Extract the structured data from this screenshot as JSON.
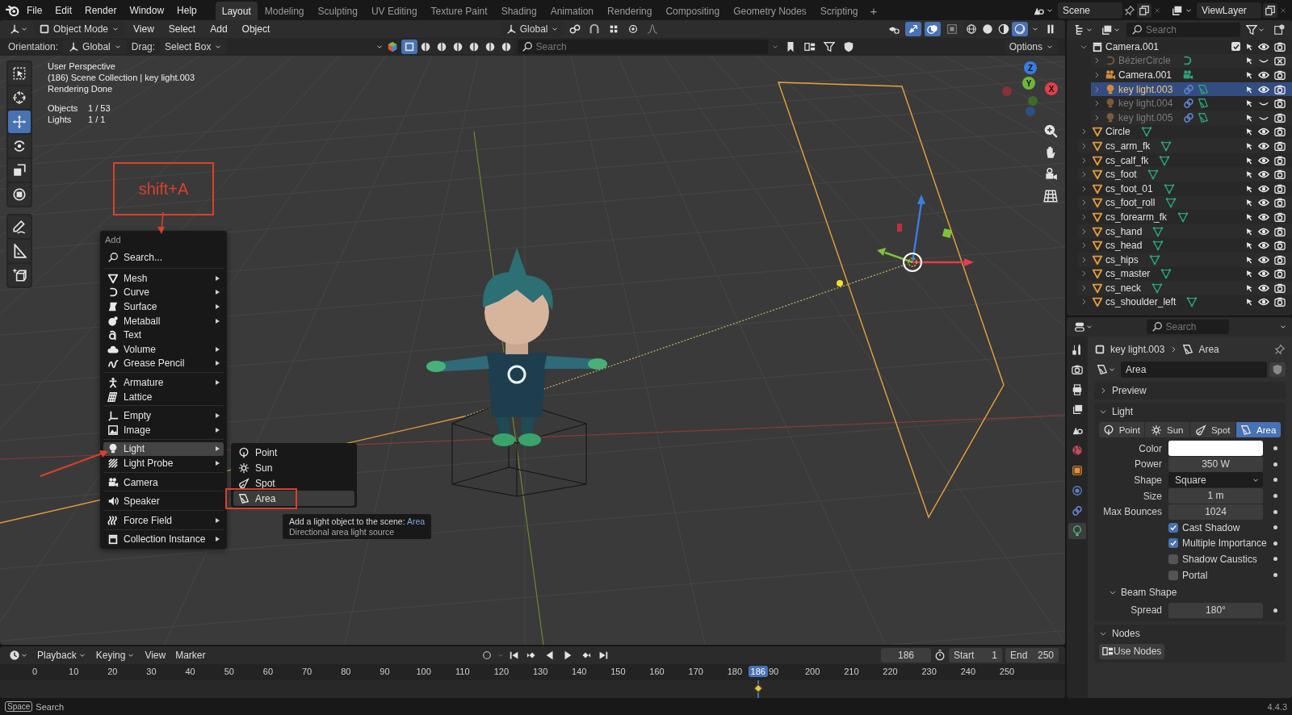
{
  "topbar": {
    "menus": [
      "File",
      "Edit",
      "Render",
      "Window",
      "Help"
    ],
    "workspaces": [
      {
        "label": "Layout",
        "selected": true
      },
      {
        "label": "Modeling",
        "selected": false
      },
      {
        "label": "Sculpting",
        "selected": false
      },
      {
        "label": "UV Editing",
        "selected": false
      },
      {
        "label": "Texture Paint",
        "selected": false
      },
      {
        "label": "Shading",
        "selected": false
      },
      {
        "label": "Animation",
        "selected": false
      },
      {
        "label": "Rendering",
        "selected": false
      },
      {
        "label": "Compositing",
        "selected": false
      },
      {
        "label": "Geometry Nodes",
        "selected": false
      },
      {
        "label": "Scripting",
        "selected": false
      }
    ],
    "add_tab": "+",
    "scene": "Scene",
    "view_layer": "ViewLayer"
  },
  "viewport": {
    "mode": "Object Mode",
    "menus": [
      "View",
      "Select",
      "Add",
      "Object"
    ],
    "transform": "Global",
    "toggles": [
      {
        "kind": "gizmo",
        "on": true
      },
      {
        "kind": "overlay",
        "on": true
      },
      {
        "kind": "xray",
        "on": false
      }
    ],
    "shading": [
      {
        "kind": "wire",
        "selected": false
      },
      {
        "kind": "solid",
        "selected": false
      },
      {
        "kind": "material",
        "selected": false
      },
      {
        "kind": "rendered",
        "selected": true
      }
    ],
    "orientation_label": "Orientation:",
    "orientation": "Global",
    "drag_label": "Drag:",
    "drag": "Select Box",
    "select_modes": [
      {
        "selected": true
      },
      {
        "selected": false
      },
      {
        "selected": false
      },
      {
        "selected": false
      },
      {
        "selected": false
      },
      {
        "selected": false
      },
      {
        "selected": false
      }
    ],
    "search_placeholder": "Search",
    "options": "Options",
    "overlay": [
      "User Perspective",
      "(186) Scene Collection | key light.003",
      "Rendering Done"
    ],
    "stats": [
      {
        "label": "Objects",
        "value": "1 / 53"
      },
      {
        "label": "Lights",
        "value": "1 / 1"
      }
    ],
    "tools": [
      {
        "kind": "select",
        "selected": false
      },
      {
        "kind": "cursor",
        "selected": false
      },
      {
        "kind": "move",
        "selected": true
      },
      {
        "kind": "rotate",
        "selected": false
      },
      {
        "kind": "scale",
        "selected": false
      },
      {
        "kind": "transform",
        "selected": false
      },
      {
        "kind": "annotate",
        "selected": false
      },
      {
        "kind": "measure",
        "selected": false
      },
      {
        "kind": "add_cube",
        "selected": false
      }
    ],
    "axes": [
      {
        "kind": "z",
        "label": "Z"
      },
      {
        "kind": "y",
        "label": "Y"
      },
      {
        "kind": "x",
        "label": "X"
      }
    ],
    "annotation": "shift+A",
    "add_menu": {
      "title": "Add",
      "search": "Search...",
      "groups": [
        [
          {
            "kind": "mesh",
            "label": "Mesh",
            "submenu": true,
            "selected": false
          },
          {
            "kind": "curve",
            "label": "Curve",
            "submenu": true,
            "selected": false
          },
          {
            "kind": "surface",
            "label": "Surface",
            "submenu": true,
            "selected": false
          },
          {
            "kind": "metaball",
            "label": "Metaball",
            "submenu": true,
            "selected": false
          },
          {
            "kind": "text",
            "label": "Text",
            "submenu": false,
            "selected": false
          },
          {
            "kind": "volume",
            "label": "Volume",
            "submenu": true,
            "selected": false
          },
          {
            "kind": "grease_pencil",
            "label": "Grease Pencil",
            "submenu": true,
            "selected": false
          }
        ],
        [
          {
            "kind": "armature",
            "label": "Armature",
            "submenu": true,
            "selected": false
          },
          {
            "kind": "lattice",
            "label": "Lattice",
            "submenu": false,
            "selected": false
          }
        ],
        [
          {
            "kind": "empty",
            "label": "Empty",
            "submenu": true,
            "selected": false
          },
          {
            "kind": "image",
            "label": "Image",
            "submenu": true,
            "selected": false
          }
        ],
        [
          {
            "kind": "light",
            "label": "Light",
            "submenu": true,
            "selected": true
          },
          {
            "kind": "light_probe",
            "label": "Light Probe",
            "submenu": true,
            "selected": false
          }
        ],
        [
          {
            "kind": "camera",
            "label": "Camera",
            "submenu": false,
            "selected": false
          }
        ],
        [
          {
            "kind": "speaker",
            "label": "Speaker",
            "submenu": false,
            "selected": false
          }
        ],
        [
          {
            "kind": "force_field",
            "label": "Force Field",
            "submenu": true,
            "selected": false
          }
        ],
        [
          {
            "kind": "collection",
            "label": "Collection Instance",
            "submenu": true,
            "selected": false
          }
        ]
      ]
    },
    "light_menu": [
      {
        "kind": "point",
        "label": "Point",
        "selected": false
      },
      {
        "kind": "sun",
        "label": "Sun",
        "selected": false
      },
      {
        "kind": "spot",
        "label": "Spot",
        "selected": false
      },
      {
        "kind": "area",
        "label": "Area",
        "selected": true
      }
    ],
    "tooltip": {
      "text": "Add a light object to the scene: **Area**",
      "description": "Directional area light source"
    }
  },
  "outliner": {
    "search_placeholder": "Search",
    "rows": [
      {
        "kind": "collection",
        "name": "Camera.001",
        "expanded": true,
        "checked": true,
        "selected": false,
        "visible": true,
        "renderable": true,
        "children": [
          {
            "kind": "curve",
            "name": "BézierCircle",
            "expanded": false,
            "selected": false,
            "visible": false,
            "renderable": false
          },
          {
            "kind": "camera",
            "name": "Camera.001",
            "expanded": false,
            "selected": false,
            "visible": true,
            "renderable": true
          },
          {
            "kind": "light",
            "name": "key light.003",
            "expanded": false,
            "selected": true,
            "visible": true,
            "renderable": true
          },
          {
            "kind": "light",
            "name": "key light.004",
            "expanded": false,
            "selected": false,
            "visible": false,
            "renderable": true
          },
          {
            "kind": "light",
            "name": "key light.005",
            "expanded": false,
            "selected": false,
            "visible": false,
            "renderable": true
          }
        ]
      },
      {
        "kind": "mesh",
        "name": "Circle",
        "expanded": false,
        "selected": false,
        "visible": true,
        "renderable": true
      },
      {
        "kind": "mesh",
        "name": "cs_arm_fk",
        "expanded": false,
        "selected": false,
        "visible": true,
        "renderable": true
      },
      {
        "kind": "mesh",
        "name": "cs_calf_fk",
        "expanded": false,
        "selected": false,
        "visible": true,
        "renderable": true
      },
      {
        "kind": "mesh",
        "name": "cs_foot",
        "expanded": false,
        "selected": false,
        "visible": true,
        "renderable": true
      },
      {
        "kind": "mesh",
        "name": "cs_foot_01",
        "expanded": false,
        "selected": false,
        "visible": true,
        "renderable": true
      },
      {
        "kind": "mesh",
        "name": "cs_foot_roll",
        "expanded": false,
        "selected": false,
        "visible": true,
        "renderable": true
      },
      {
        "kind": "mesh",
        "name": "cs_forearm_fk",
        "expanded": false,
        "selected": false,
        "visible": true,
        "renderable": true
      },
      {
        "kind": "mesh",
        "name": "cs_hand",
        "expanded": false,
        "selected": false,
        "visible": true,
        "renderable": true
      },
      {
        "kind": "mesh",
        "name": "cs_head",
        "expanded": false,
        "selected": false,
        "visible": true,
        "renderable": true
      },
      {
        "kind": "mesh",
        "name": "cs_hips",
        "expanded": false,
        "selected": false,
        "visible": true,
        "renderable": true
      },
      {
        "kind": "mesh",
        "name": "cs_master",
        "expanded": false,
        "selected": false,
        "visible": true,
        "renderable": true
      },
      {
        "kind": "mesh",
        "name": "cs_neck",
        "expanded": false,
        "selected": false,
        "visible": true,
        "renderable": true
      },
      {
        "kind": "mesh",
        "name": "cs_shoulder_left",
        "expanded": false,
        "selected": false,
        "visible": true,
        "renderable": true
      }
    ]
  },
  "properties": {
    "search_placeholder": "Search",
    "tabs": [
      {
        "kind": "tool",
        "selected": false
      },
      {
        "kind": "render",
        "selected": false
      },
      {
        "kind": "output",
        "selected": false
      },
      {
        "kind": "view_layer",
        "selected": false
      },
      {
        "kind": "scene",
        "selected": false
      },
      {
        "kind": "world",
        "selected": false
      },
      {
        "kind": "object",
        "selected": false
      },
      {
        "kind": "physics",
        "selected": false
      },
      {
        "kind": "constraints",
        "selected": false
      },
      {
        "kind": "data",
        "selected": true
      }
    ],
    "breadcrumb": [
      "key light.003",
      "Area"
    ],
    "datablock": "Area",
    "panels": [
      {
        "title": "Preview",
        "expanded": false
      },
      {
        "title": "Light",
        "expanded": true,
        "light_types": [
          {
            "kind": "point",
            "label": "Point",
            "selected": false
          },
          {
            "kind": "sun",
            "label": "Sun",
            "selected": false
          },
          {
            "kind": "spot",
            "label": "Spot",
            "selected": false
          },
          {
            "kind": "area",
            "label": "Area",
            "selected": true
          }
        ],
        "fields": [
          {
            "kind": "color",
            "label": "Color",
            "color": "#ffffff"
          },
          {
            "kind": "number",
            "label": "Power",
            "value": "350 W"
          },
          {
            "kind": "dropdown",
            "label": "Shape",
            "value": "Square"
          },
          {
            "kind": "number",
            "label": "Size",
            "value": "1 m"
          },
          {
            "kind": "number",
            "label": "Max Bounces",
            "value": "1024"
          },
          {
            "kind": "checkbox",
            "label": "Cast Shadow",
            "checked": true
          },
          {
            "kind": "checkbox",
            "label": "Multiple Importance",
            "checked": true
          },
          {
            "kind": "checkbox",
            "label": "Shadow Caustics",
            "checked": false
          },
          {
            "kind": "checkbox",
            "label": "Portal",
            "checked": false
          }
        ],
        "subpanels": [
          {
            "title": "Beam Shape",
            "expanded": true,
            "fields": [
              {
                "kind": "number",
                "label": "Spread",
                "value": "180°"
              }
            ]
          }
        ]
      },
      {
        "title": "Nodes",
        "expanded": true,
        "button": "Use Nodes"
      }
    ]
  },
  "timeline": {
    "menus": [
      {
        "label": "Playback",
        "dropdown": true
      },
      {
        "label": "Keying",
        "dropdown": true
      },
      {
        "label": "View",
        "dropdown": false
      },
      {
        "label": "Marker",
        "dropdown": false
      }
    ],
    "current_frame": "186",
    "start_label": "Start",
    "start": "1",
    "end_label": "End",
    "end": "250",
    "ruler": [
      "0",
      "10",
      "20",
      "30",
      "40",
      "50",
      "60",
      "70",
      "80",
      "90",
      "100",
      "110",
      "120",
      "130",
      "140",
      "150",
      "160",
      "170",
      "180",
      "90",
      "200",
      "210",
      "220",
      "230",
      "240",
      "250"
    ],
    "playhead": {
      "label": "186",
      "level": 0.744
    }
  },
  "status_bar": {
    "key": "Space",
    "label": "Search",
    "version": "4.4.3"
  }
}
